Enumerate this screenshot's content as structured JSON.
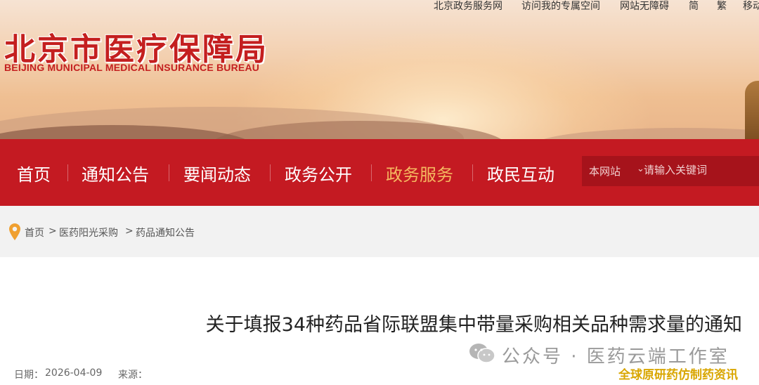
{
  "header": {
    "logo_cn": "北京市医疗保障局",
    "logo_en": "BEIJING MUNICIPAL MEDICAL INSURANCE BUREAU",
    "top_links": [
      "北京政务服务网",
      "访问我的专属空间",
      "网站无障碍",
      "简",
      "繁",
      "移动"
    ]
  },
  "nav": {
    "items": [
      "首页",
      "通知公告",
      "要闻动态",
      "政务公开",
      "政务服务",
      "政民互动"
    ],
    "active": "政务服务"
  },
  "search": {
    "scope": "本网站",
    "placeholder": "请输入关键词"
  },
  "breadcrumb": [
    "首页",
    "医药阳光采购",
    "药品通知公告"
  ],
  "breadcrumb_separator": ">",
  "article": {
    "title": "关于填报34种药品省际联盟集中带量采购相关品种需求量的通知",
    "date_label": "日期：",
    "date": "2026-04-09",
    "source_label": "来源："
  },
  "watermark": {
    "text": "公众号 · 医药云端工作室",
    "tag": "全球原研药仿制药资讯"
  },
  "colors": {
    "brand_red": "#c41a22",
    "active_nav": "#f5b860",
    "breadcrumb_bg": "#f2f2f2",
    "watermark_tag": "#d9a600"
  }
}
